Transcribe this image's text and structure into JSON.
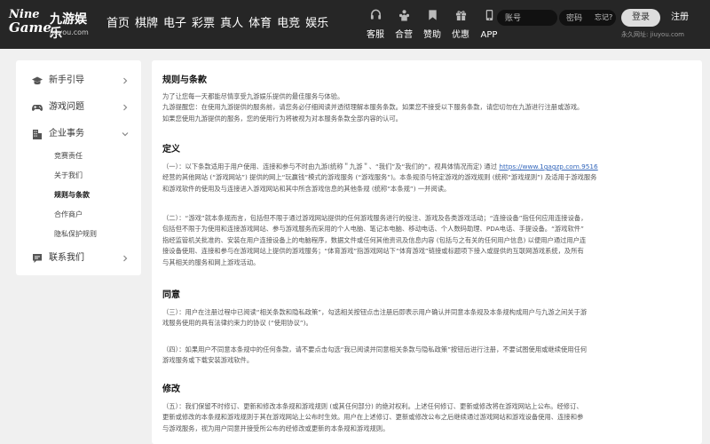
{
  "header": {
    "logo_en_1": "Nine",
    "logo_en_2": "Game",
    "logo_cn": "九游娱乐",
    "logo_url": "jiuyou.com",
    "nav": [
      "首页",
      "棋牌",
      "电子",
      "彩票",
      "真人",
      "体育",
      "电竞",
      "娱乐"
    ],
    "tools": [
      {
        "label": "客服",
        "icon": "headset-icon"
      },
      {
        "label": "合营",
        "icon": "partner-icon"
      },
      {
        "label": "赞助",
        "icon": "bookmark-icon"
      },
      {
        "label": "优惠",
        "icon": "gift-icon"
      },
      {
        "label": "APP",
        "icon": "phone-icon"
      }
    ],
    "account_placeholder": "账号",
    "password_placeholder": "密码",
    "forgot": "忘记?",
    "login": "登录",
    "register": "注册",
    "permanent_url": "永久网址: jiuyou.com"
  },
  "sidebar": {
    "items": [
      {
        "label": "新手引导",
        "icon": "graduation-cap-icon"
      },
      {
        "label": "游戏问题",
        "icon": "gamepad-icon"
      },
      {
        "label": "企业事务",
        "icon": "building-icon"
      },
      {
        "label": "联系我们",
        "icon": "chat-icon"
      }
    ],
    "sub_items": [
      "竞赛责任",
      "关于我们",
      "规则与条款",
      "合作商户",
      "隐私保护规则"
    ],
    "active_sub": "规则与条款"
  },
  "content": {
    "title": "规则与条款",
    "intro_1": "为了让您每一天都能尽情享受九游娱乐提供的最佳服务与体验。",
    "intro_2": "九游提醒您：在使用九游提供的服务前，请您务必仔细阅读并透彻理解本服务条款。如果您不接受以下服务条款，请您切勿在九游进行注册或游戏。",
    "intro_3": "如果您使用九游提供的服务，您的使用行为将被视为对本服务条款全部内容的认可。",
    "sections": [
      {
        "title": "定义",
        "paras": [
          {
            "pre": "（一）：以下条款适用于用户使用、连接和参与不时由九游(统称＂九游＂、“我们”及“我们的”，视具体情况而定) 通过 ",
            "link": "https://www.1gagzp.com.9516",
            "lines": [
              "经营的其他网站 (“游戏网站”) 提供的网上“玩赢钱”模式的游戏服务 (“游戏服务”)。本条规须与特定游戏的游戏规则 (统称“游戏规则”) 及适用于游戏服务",
              "和游戏软件的使用及与连接进入游戏网站和其中所含游戏信息的其他条规 (统称“本条规”) 一并阅读。"
            ]
          },
          {
            "lines": [
              "（二）：“游戏”就本条规而言，包括但不限于通过游戏网站提供的任何游戏服务进行的投注、游戏及各类游戏活动；“连接设备”指任何应用连接设备，",
              "包括但不限于为使用和连接游戏网站、参与游戏服务而采用的个人电脑、笔记本电脑、移动电话、个人数码助理、PDA电话、手提设备。“游戏软件”",
              "指经监管机关批准的、安装在用户连接设备上的电脑程序，数据文件或任何其他资讯及信息内容 (包括与之有关的任何用户信息) 以便用户通过用户连",
              "接设备使用、连接和参与在游戏网站上提供的游戏服务；“体育游戏”指游戏网站下“体育游戏”链接或标题项下接入或提供的互联网游戏系统，及所有",
              "与其相关的服务和网上游戏活动。"
            ]
          }
        ]
      },
      {
        "title": "同意",
        "paras": [
          {
            "lines": [
              "（三）：用户在注册过程中已阅读“相关条款和隐私政策”，勾选相关按钮点击注册后即表示用户确认并同意本条规及本条规构成用户与九游之间关于游",
              "戏服务使用的具有法律约束力的协议 (“使用协议”)。"
            ]
          },
          {
            "lines": [
              "（四）：如果用户不同意本条规中的任何条款，请不要点击勾选“我已阅读并同意相关条款与隐私政策”按钮后进行注册，不要试图使用或继续使用任何",
              "游戏服务或下载安装游戏软件。"
            ]
          }
        ]
      },
      {
        "title": "修改",
        "paras": [
          {
            "lines": [
              "（五）：我们保留不时修订、更新和修改本条规和游戏规则 (或其任何部分) 的绝对权利。上述任何修订、更新或修改将在游戏网站上公布。经修订、",
              "更新或修改的本条规和游戏规则于其在游戏网站上公布时生效。用户在上述修订、更新或修改公布之后继续通过游戏网站和游戏设备使用、连接和参",
              "与游戏服务，视为用户同意并接受所公布的经修改或更新的本条规和游戏规则。"
            ]
          }
        ]
      }
    ]
  }
}
